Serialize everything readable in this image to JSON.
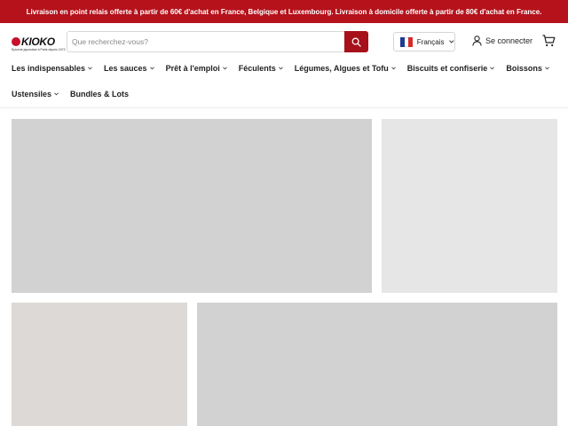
{
  "promo": {
    "text": "Livraison en point relais offerte à partir de 60€ d'achat en France, Belgique et Luxembourg. Livraison à domicile offerte à partir de 80€ d'achat en France."
  },
  "header": {
    "logo_text": "KIOKO",
    "logo_tagline": "Épicerie japonaise à Paris depuis 1972",
    "search_placeholder": "Que recherchez-vous?",
    "language": "Français",
    "login": "Se connecter"
  },
  "nav": {
    "row1": [
      {
        "label": "Les indispensables",
        "has_dropdown": true
      },
      {
        "label": "Les sauces",
        "has_dropdown": true
      },
      {
        "label": "Prêt à l'emploi",
        "has_dropdown": true
      },
      {
        "label": "Féculents",
        "has_dropdown": true
      },
      {
        "label": "Légumes, Algues et Tofu",
        "has_dropdown": true
      },
      {
        "label": "Biscuits et confiserie",
        "has_dropdown": true
      },
      {
        "label": "Boissons",
        "has_dropdown": true
      }
    ],
    "row2": [
      {
        "label": "Ustensiles",
        "has_dropdown": true
      },
      {
        "label": "Bundles & Lots",
        "has_dropdown": false
      }
    ]
  },
  "colors": {
    "brand_red": "#b5121b",
    "search_button": "#a6111a",
    "placeholder_gray": "#d2d2d2"
  }
}
